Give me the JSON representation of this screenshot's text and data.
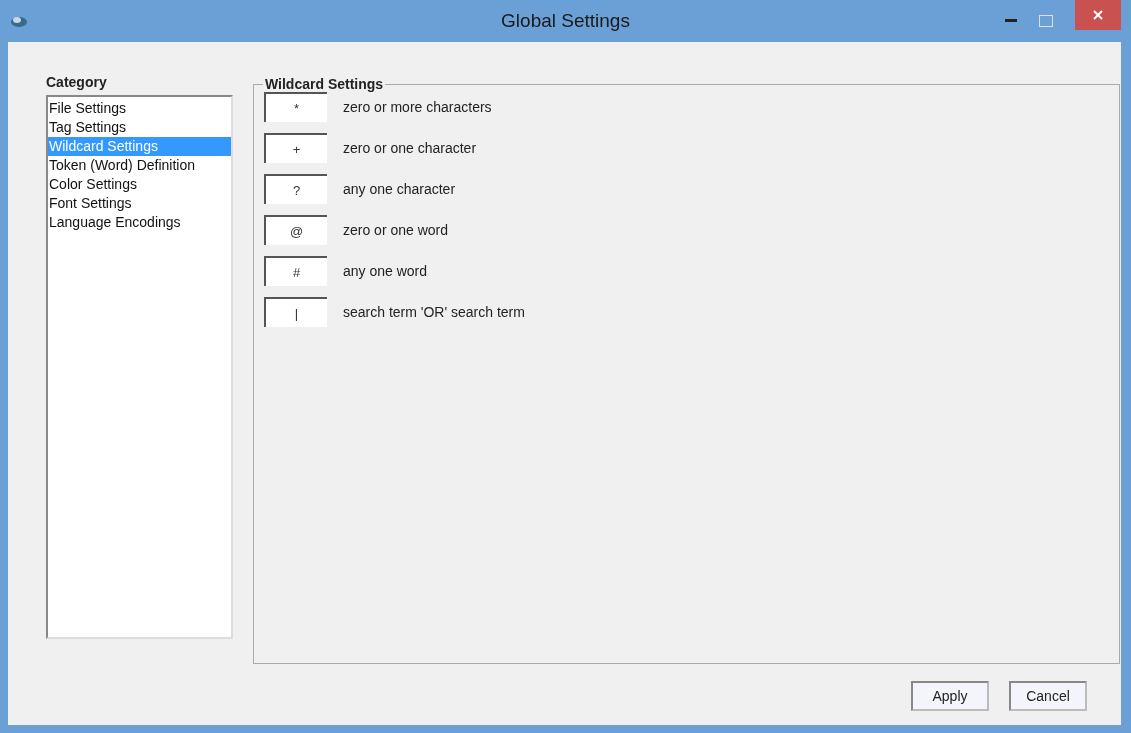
{
  "window": {
    "title": "Global Settings"
  },
  "category": {
    "label": "Category",
    "items": [
      {
        "label": "File Settings",
        "selected": false
      },
      {
        "label": "Tag Settings",
        "selected": false
      },
      {
        "label": "Wildcard Settings",
        "selected": true
      },
      {
        "label": "Token (Word) Definition",
        "selected": false
      },
      {
        "label": "Color Settings",
        "selected": false
      },
      {
        "label": "Font Settings",
        "selected": false
      },
      {
        "label": "Language Encodings",
        "selected": false
      }
    ]
  },
  "wildcard_settings": {
    "title": "Wildcard Settings",
    "rows": [
      {
        "value": "*",
        "description": "zero or more characters"
      },
      {
        "value": "+",
        "description": "zero or one character"
      },
      {
        "value": "?",
        "description": "any one character"
      },
      {
        "value": "@",
        "description": "zero or one word"
      },
      {
        "value": "#",
        "description": "any one word"
      },
      {
        "value": "|",
        "description": "search term 'OR' search term"
      }
    ]
  },
  "buttons": [
    "Apply",
    "Cancel"
  ]
}
